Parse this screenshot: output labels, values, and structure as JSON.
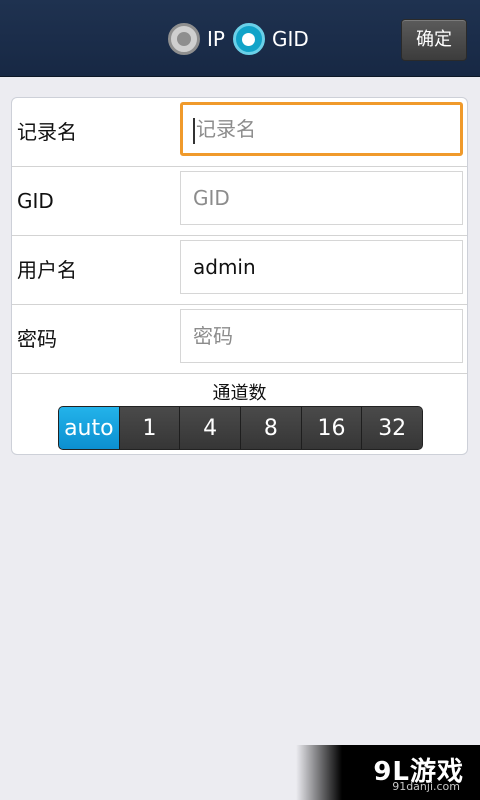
{
  "header": {
    "mode_options": [
      {
        "label": "IP",
        "selected": false
      },
      {
        "label": "GID",
        "selected": true
      }
    ],
    "confirm_label": "确定"
  },
  "form": {
    "record_name": {
      "label": "记录名",
      "placeholder": "记录名",
      "value": ""
    },
    "gid": {
      "label": "GID",
      "placeholder": "GID",
      "value": ""
    },
    "username": {
      "label": "用户名",
      "value": "admin"
    },
    "password": {
      "label": "密码",
      "placeholder": "密码",
      "value": ""
    },
    "channels": {
      "title": "通道数",
      "options": [
        "auto",
        "1",
        "4",
        "8",
        "16",
        "32"
      ],
      "selected": "auto"
    }
  },
  "watermark": {
    "text": "9L游戏",
    "url_text": "91danji.com"
  },
  "colors": {
    "header_bg": "#1f3250",
    "radio_active": "#11a3c8",
    "focus_border": "#f09a2b",
    "segment_active": "#18a3e0"
  }
}
